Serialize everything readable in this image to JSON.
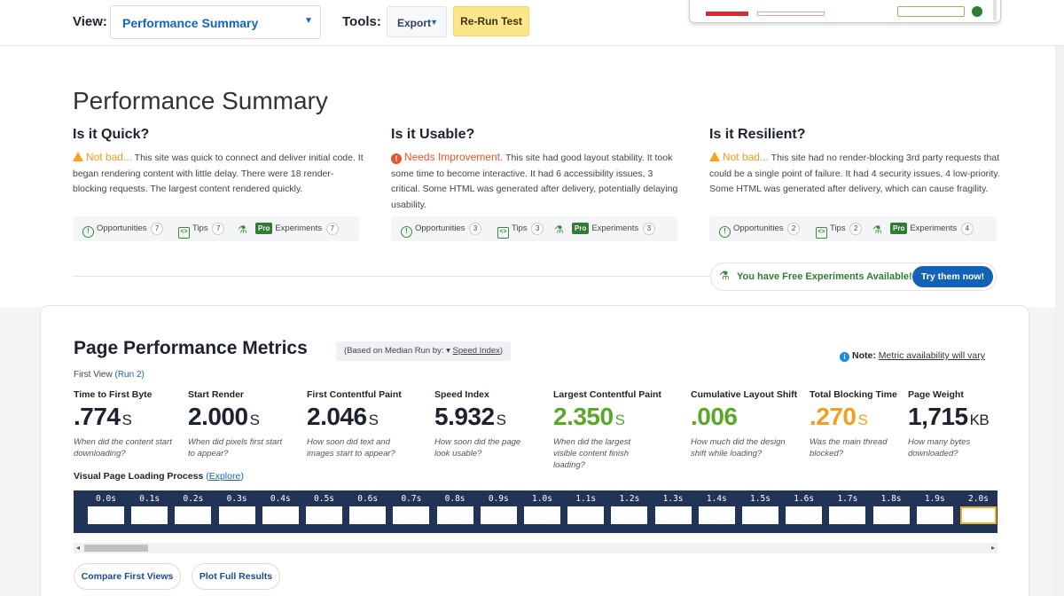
{
  "toolbar": {
    "view_label": "View:",
    "view_value": "Performance Summary",
    "tools_label": "Tools:",
    "export_label": "Export",
    "rerun_label": "Re-Run Test"
  },
  "summary": {
    "title": "Performance Summary",
    "columns": [
      {
        "heading": "Is it Quick?",
        "status": "Not bad...",
        "status_type": "warning",
        "text": " This site was quick to connect and deliver initial code. It began rendering content with little delay. There were 18 render-blocking requests. The largest content rendered quickly.",
        "opportunities_label": "Opportunities",
        "opportunities": "7",
        "tips_label": "Tips",
        "tips": "7",
        "pro_label": "Pro",
        "experiments_label": "Experiments",
        "experiments": "7"
      },
      {
        "heading": "Is it Usable?",
        "status": "Needs Improvement.",
        "status_type": "error",
        "text": " This site had good layout stability. It took some time to become interactive. It had 6 accessibility issues, 3 critical. Some HTML was generated after delivery, potentially delaying usability.",
        "opportunities_label": "Opportunities",
        "opportunities": "3",
        "tips_label": "Tips",
        "tips": "3",
        "pro_label": "Pro",
        "experiments_label": "Experiments",
        "experiments": "3"
      },
      {
        "heading": "Is it Resilient?",
        "status": "Not bad...",
        "status_type": "warning",
        "text": " This site had no render-blocking 3rd party requests that could be a single point of failure. It had 4 security issues, 4 low-priority. Some HTML was generated after delivery, which can cause fragility.",
        "opportunities_label": "Opportunities",
        "opportunities": "2",
        "tips_label": "Tips",
        "tips": "2",
        "pro_label": "Pro",
        "experiments_label": "Experiments",
        "experiments": "4"
      }
    ],
    "free_experiments_text": "You have Free Experiments Available!",
    "try_label": "Try them now!"
  },
  "metrics": {
    "title": "Page Performance Metrics",
    "median_prefix": "(Based on Median Run by: ▾",
    "median_link": "Speed Index",
    "median_suffix": ")",
    "note_label": "Note:",
    "note_text": "Metric availability will vary",
    "first_view": "First View",
    "run_link": "(Run 2)",
    "items": [
      {
        "label": "Time to First Byte",
        "value": ".774",
        "unit": "S",
        "color": "#1e2130",
        "question": "When did the content start downloading?"
      },
      {
        "label": "Start Render",
        "value": "2.000",
        "unit": "S",
        "color": "#1e2130",
        "question": "When did pixels first start to appear?"
      },
      {
        "label": "First Contentful Paint",
        "value": "2.046",
        "unit": "S",
        "color": "#1e2130",
        "question": "How soon did text and images start to appear?"
      },
      {
        "label": "Speed Index",
        "value": "5.932",
        "unit": "S",
        "color": "#1e2130",
        "question": "How soon did the page look usable?"
      },
      {
        "label": "Largest Contentful Paint",
        "value": "2.350",
        "unit": "S",
        "color": "#5aa82a",
        "question": "When did the largest visible content finish loading?"
      },
      {
        "label": "Cumulative Layout Shift",
        "value": ".006",
        "unit": "",
        "color": "#5aa82a",
        "question": "How much did the design shift while loading?"
      },
      {
        "label": "Total Blocking Time",
        "value": ".270",
        "unit": "S",
        "color": "#f0a020",
        "question": "Was the main thread blocked?"
      },
      {
        "label": "Page Weight",
        "value": "1,715",
        "unit": "KB",
        "color": "#1e2130",
        "question": "How many bytes downloaded?"
      }
    ],
    "visual_loading_label": "Visual Page Loading Process",
    "explore_link": "Explore",
    "frames": [
      "0.0s",
      "0.1s",
      "0.2s",
      "0.3s",
      "0.4s",
      "0.5s",
      "0.6s",
      "0.7s",
      "0.8s",
      "0.9s",
      "1.0s",
      "1.1s",
      "1.2s",
      "1.3s",
      "1.4s",
      "1.5s",
      "1.6s",
      "1.7s",
      "1.8s",
      "1.9s",
      "2.0s"
    ],
    "compare_label": "Compare First Views",
    "plot_label": "Plot Full Results"
  },
  "colors": {
    "accent_blue": "#1565c0",
    "rerun_yellow": "#fde68a",
    "filmstrip_bg": "#223358",
    "green": "#5aa82a",
    "orange": "#f0a020",
    "warning": "#f4a524",
    "error": "#e8542d"
  }
}
